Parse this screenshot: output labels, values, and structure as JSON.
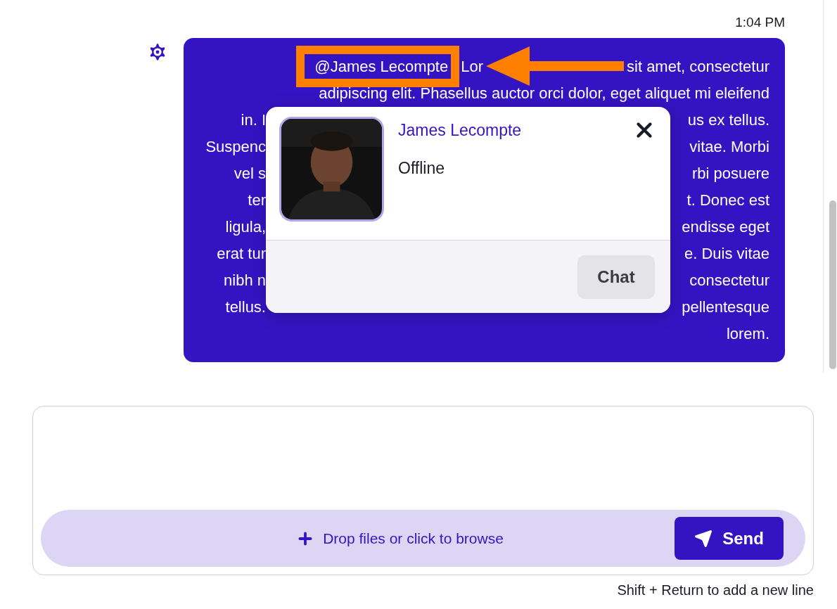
{
  "timestamp": "1:04 PM",
  "message": {
    "lines": [
      {
        "kind": "mention",
        "mention": "@James Lecompte",
        "fragments": [
          "Lor",
          "sit amet, consectetur"
        ]
      },
      {
        "kind": "full",
        "text": "adipiscing elit. Phasellus auctor orci dolor, eget aliquet mi eleifend"
      },
      {
        "kind": "split",
        "left": "in. I",
        "right": "us ex tellus."
      },
      {
        "kind": "split",
        "left": "Suspenc",
        "right": "vitae. Morbi"
      },
      {
        "kind": "split",
        "left": "vel s",
        "right": "rbi posuere"
      },
      {
        "kind": "split",
        "left": "ter",
        "right": "t. Donec est"
      },
      {
        "kind": "split",
        "left": "ligula,",
        "right": "endisse eget"
      },
      {
        "kind": "split",
        "left": "erat tur",
        "right": "e. Duis vitae"
      },
      {
        "kind": "split",
        "left": "nibh n",
        "right": "consectetur"
      },
      {
        "kind": "split",
        "left": "tellus.",
        "right": "pellentesque"
      },
      {
        "kind": "full",
        "text": "lorem."
      }
    ]
  },
  "mention_popup": {
    "name": "James Lecompte",
    "status": "Offline",
    "button": "Chat"
  },
  "composer": {
    "upload_hint": "Drop files or click to browse",
    "send_button": "Send",
    "footer_hint": "Shift + Return to add a new line"
  }
}
